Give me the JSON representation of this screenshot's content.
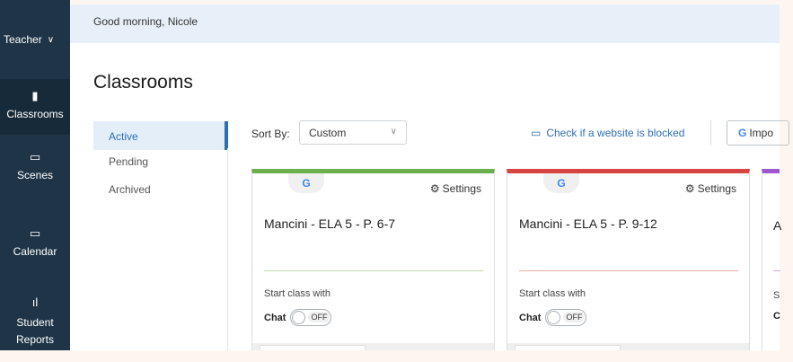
{
  "sidebar": {
    "role": "Teacher",
    "role_caret": "∨",
    "items": [
      {
        "label": "Classrooms",
        "icon": "▮",
        "active": true
      },
      {
        "label": "Scenes",
        "icon": "▭",
        "active": false
      },
      {
        "label": "Calendar",
        "icon": "▭",
        "active": false
      },
      {
        "label": "Student Reports",
        "icon": "ıl",
        "active": false
      }
    ]
  },
  "topbar": {
    "greeting": "Good morning, Nicole"
  },
  "page": {
    "title": "Classrooms"
  },
  "subnav": {
    "items": [
      "Active",
      "Pending",
      "Archived"
    ]
  },
  "toolbar": {
    "sort_label": "Sort By:",
    "sort_value": "Custom",
    "check_link": "Check if a website is blocked",
    "import_label": "Impo",
    "import_icon": "G"
  },
  "cards": [
    {
      "name": "Mancini - ELA 5 - P. 6-7",
      "settings": "Settings",
      "provider_icon": "G",
      "start_label": "Start class with",
      "chat_label": "Chat",
      "chat_state": "OFF",
      "accent": "#6ab04c",
      "line": "#bcd9a8"
    },
    {
      "name": "Mancini - ELA 5 - P. 9-12",
      "settings": "Settings",
      "provider_icon": "G",
      "start_label": "Start class with",
      "chat_label": "Chat",
      "chat_state": "OFF",
      "accent": "#d64541",
      "line": "#eab0ae"
    }
  ],
  "card_partial": {
    "letter": "A",
    "start_initial": "S",
    "chat_initial": "C",
    "accent": "#9b59d0"
  },
  "colors": {
    "sidebar": "#1f3547",
    "link": "#2d6fb3",
    "topbar": "#e7f0f8"
  }
}
